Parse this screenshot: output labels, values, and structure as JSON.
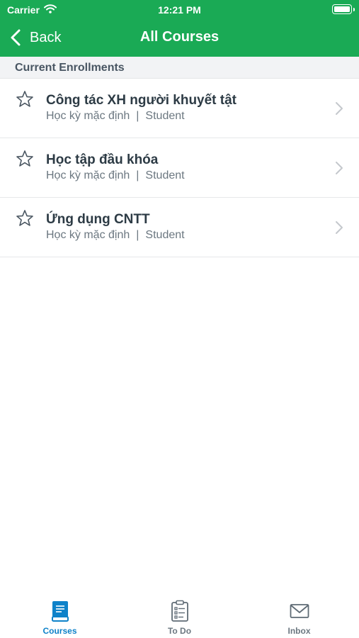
{
  "status_bar": {
    "carrier": "Carrier",
    "time": "12:21 PM"
  },
  "nav": {
    "back_label": "Back",
    "title": "All Courses"
  },
  "section": {
    "title": "Current Enrollments"
  },
  "courses": [
    {
      "name": "Công tác XH người khuyết tật",
      "term": "Học kỳ mặc định",
      "separator": "|",
      "role": "Student",
      "favorite": false
    },
    {
      "name": "Học tập đầu khóa",
      "term": "Học kỳ mặc định",
      "separator": "|",
      "role": "Student",
      "favorite": false
    },
    {
      "name": "Ứng dụng CNTT",
      "term": "Học kỳ mặc định",
      "separator": "|",
      "role": "Student",
      "favorite": false
    }
  ],
  "tabs": [
    {
      "label": "Courses",
      "icon": "book-icon",
      "active": true
    },
    {
      "label": "To Do",
      "icon": "clipboard-icon",
      "active": false
    },
    {
      "label": "Inbox",
      "icon": "envelope-icon",
      "active": false
    }
  ],
  "colors": {
    "brand": "#1aaa55",
    "active_tab": "#0e82c9",
    "inactive_tab": "#6b7780"
  }
}
